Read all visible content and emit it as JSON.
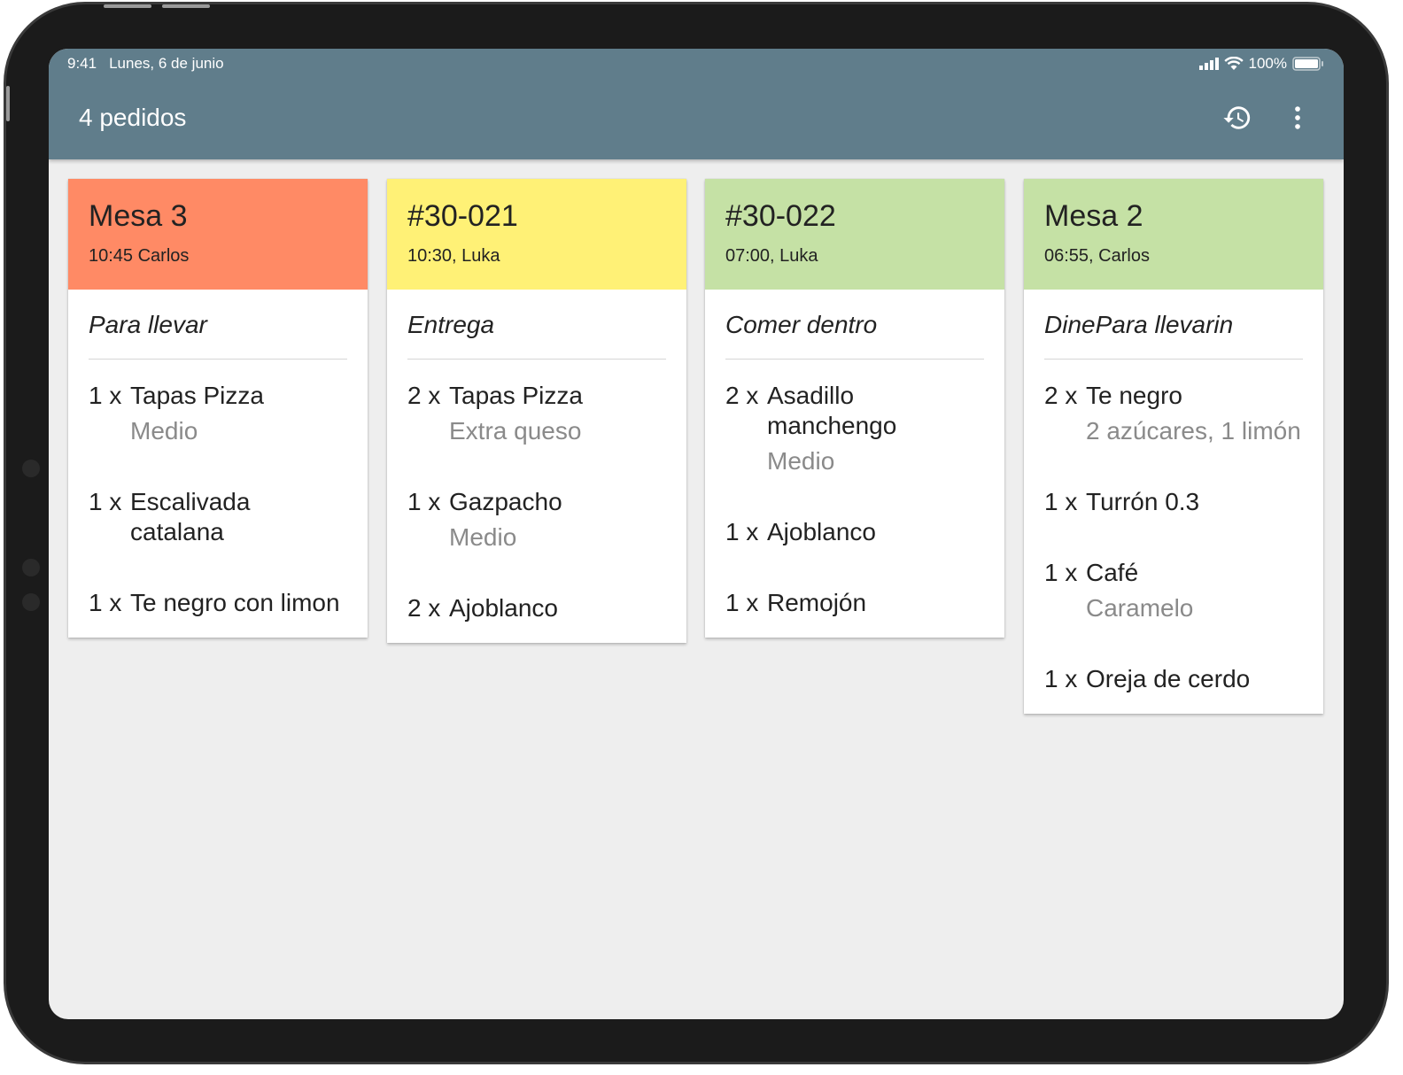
{
  "status_bar": {
    "time": "9:41",
    "date": "Lunes, 6 de junio",
    "battery": "100%"
  },
  "appbar": {
    "title": "4 pedidos",
    "history_icon": "history-icon",
    "menu_icon": "more-vertical-icon"
  },
  "colors": {
    "appbar": "#607d8b",
    "red": "#ff8a65",
    "yellow": "#fff176",
    "green": "#c5e1a5"
  },
  "orders": [
    {
      "title": "Mesa 3",
      "subtitle": "10:45 Carlos",
      "color": "#ff8a65",
      "type": "Para llevar",
      "items": [
        {
          "qty": "1 x",
          "name": "Tapas Pizza",
          "mod": "Medio"
        },
        {
          "qty": "1 x",
          "name": "Escalivada catalana",
          "mod": ""
        },
        {
          "qty": "1 x",
          "name": "Te negro con limon",
          "mod": ""
        }
      ]
    },
    {
      "title": "#30-021",
      "subtitle": "10:30, Luka",
      "color": "#fff176",
      "type": "Entrega",
      "items": [
        {
          "qty": "2 x",
          "name": "Tapas Pizza",
          "mod": "Extra queso"
        },
        {
          "qty": "1 x",
          "name": "Gazpacho",
          "mod": "Medio"
        },
        {
          "qty": "2 x",
          "name": "Ajoblanco",
          "mod": ""
        }
      ]
    },
    {
      "title": "#30-022",
      "subtitle": "07:00, Luka",
      "color": "#c5e1a5",
      "type": "Comer dentro",
      "items": [
        {
          "qty": "2 x",
          "name": "Asadillo manchengo",
          "mod": "Medio"
        },
        {
          "qty": "1 x",
          "name": "Ajoblanco",
          "mod": ""
        },
        {
          "qty": "1 x",
          "name": "Remojón",
          "mod": ""
        }
      ]
    },
    {
      "title": "Mesa 2",
      "subtitle": "06:55, Carlos",
      "color": "#c5e1a5",
      "type": "DinePara llevarin",
      "items": [
        {
          "qty": "2 x",
          "name": "Te negro",
          "mod": "2 azúcares, 1 limón"
        },
        {
          "qty": "1 x",
          "name": "Turrón 0.3",
          "mod": ""
        },
        {
          "qty": "1 x",
          "name": "Café",
          "mod": "Caramelo"
        },
        {
          "qty": "1 x",
          "name": "Oreja de cerdo",
          "mod": ""
        }
      ]
    }
  ]
}
